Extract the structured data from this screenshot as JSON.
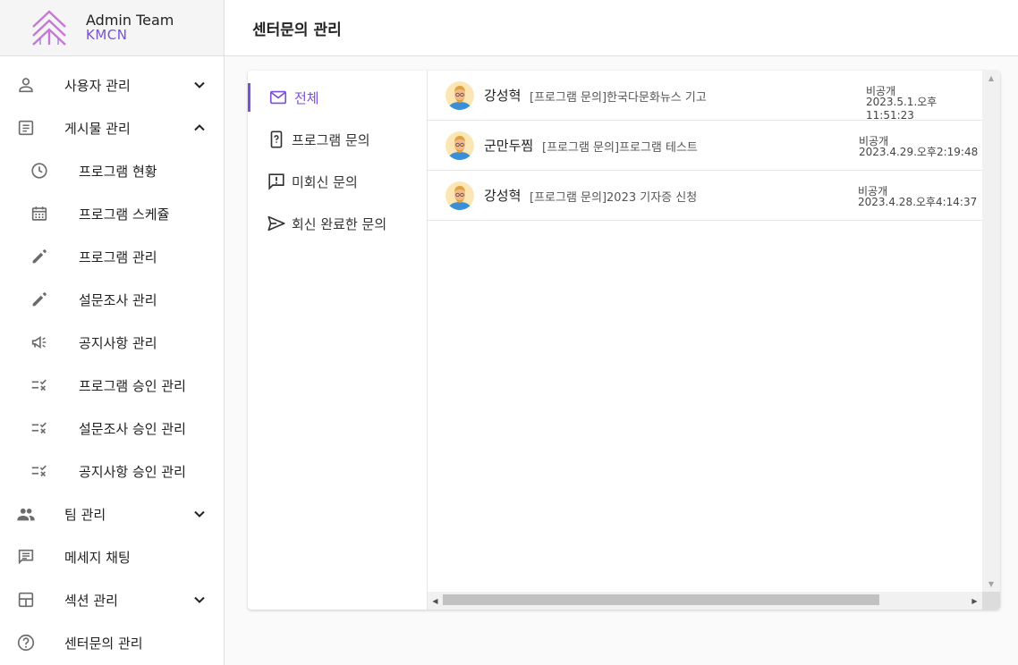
{
  "brand": {
    "title": "Admin Team",
    "subtitle": "KMCN"
  },
  "header": {
    "title": "센터문의 관리"
  },
  "sidebar": {
    "items": [
      {
        "label": "사용자 관리",
        "icon": "person-icon",
        "chevron": "down"
      },
      {
        "label": "게시물 관리",
        "icon": "article-icon",
        "chevron": "up"
      },
      {
        "label": "프로그램 현황",
        "icon": "clock-icon"
      },
      {
        "label": "프로그램 스케쥴",
        "icon": "calendar-icon"
      },
      {
        "label": "프로그램 관리",
        "icon": "pencil-icon"
      },
      {
        "label": "설문조사 관리",
        "icon": "pencil-icon"
      },
      {
        "label": "공지사항 관리",
        "icon": "megaphone-icon"
      },
      {
        "label": "프로그램 승인 관리",
        "icon": "checklist-icon"
      },
      {
        "label": "설문조사 승인 관리",
        "icon": "checklist-icon"
      },
      {
        "label": "공지사항 승인 관리",
        "icon": "checklist-icon"
      },
      {
        "label": "팀 관리",
        "icon": "people-icon",
        "chevron": "down"
      },
      {
        "label": "메세지 채팅",
        "icon": "chat-icon"
      },
      {
        "label": "섹션 관리",
        "icon": "layout-icon",
        "chevron": "down"
      },
      {
        "label": "센터문의 관리",
        "icon": "help-circle-icon"
      }
    ]
  },
  "categories": [
    {
      "label": "전체",
      "icon": "mail-icon",
      "active": true
    },
    {
      "label": "프로그램 문의",
      "icon": "phone-question-icon"
    },
    {
      "label": "미회신 문의",
      "icon": "feedback-icon"
    },
    {
      "label": "회신 완료한 문의",
      "icon": "send-icon"
    }
  ],
  "inquiries": [
    {
      "name": "강성혁",
      "subject": "[프로그램 문의]한국다문화뉴스 기고",
      "visibility": "비공개",
      "date": "2023.5.1.오후11:51:23"
    },
    {
      "name": "군만두찜",
      "subject": "[프로그램 문의]프로그램 테스트",
      "visibility": "비공개",
      "date": "2023.4.29.오후2:19:48"
    },
    {
      "name": "강성혁",
      "subject": "[프로그램 문의]2023 기자증 신청",
      "visibility": "비공개",
      "date": "2023.4.28.오후4:14:37"
    }
  ],
  "colors": {
    "accent": "#7b4fd6",
    "icon": "#6b6b6b"
  }
}
